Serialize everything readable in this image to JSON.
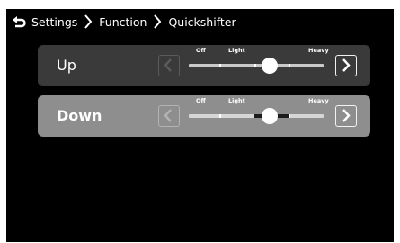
{
  "breadcrumb": {
    "items": [
      "Settings",
      "Function",
      "Quickshifter"
    ]
  },
  "icons": {
    "back": "return-arrow-icon",
    "separator": "chevron-right-icon",
    "decrease": "chevron-left-icon",
    "increase": "chevron-right-icon"
  },
  "colors": {
    "screen_bg": "#000000",
    "row_default": "#3a3a3a",
    "row_selected": "#8e8e8e",
    "text": "#ffffff"
  },
  "rows": [
    {
      "label": "Up",
      "selected": false,
      "ticks": {
        "off": "Off",
        "light": "Light",
        "heavy": "Heavy"
      },
      "level": 0.6
    },
    {
      "label": "Down",
      "selected": true,
      "ticks": {
        "off": "Off",
        "light": "Light",
        "heavy": "Heavy"
      },
      "level": 0.6
    }
  ]
}
